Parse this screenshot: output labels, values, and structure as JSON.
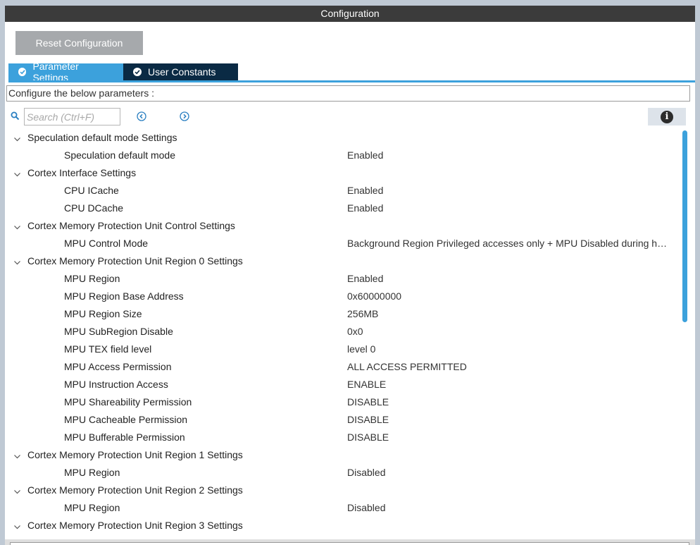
{
  "window": {
    "title": "Configuration"
  },
  "toolbar": {
    "reset_label": "Reset Configuration"
  },
  "tabs": [
    {
      "label": "Parameter Settings",
      "active": true
    },
    {
      "label": "User Constants",
      "active": false
    }
  ],
  "description": "Configure the below parameters :",
  "search": {
    "placeholder": "Search (Ctrl+F)"
  },
  "colors": {
    "accent": "#3ca1dc",
    "titlebar": "#3b3b3b",
    "tab_inactive": "#0a2a44",
    "button": "#a6a9ac"
  },
  "icons": {
    "search": "search-icon",
    "prev": "chevron-left-circle-icon",
    "next": "chevron-right-circle-icon",
    "info": "info-icon",
    "tab_check": "check-circle-icon",
    "expand": "chevron-down-icon"
  },
  "tree": {
    "groups": [
      {
        "label": "Speculation default mode Settings",
        "params": [
          {
            "name": "Speculation default mode",
            "value": "Enabled"
          }
        ]
      },
      {
        "label": "Cortex Interface Settings",
        "params": [
          {
            "name": "CPU ICache",
            "value": "Enabled"
          },
          {
            "name": "CPU DCache",
            "value": "Enabled"
          }
        ]
      },
      {
        "label": "Cortex Memory Protection Unit Control Settings",
        "params": [
          {
            "name": "MPU Control Mode",
            "value": "Background Region Privileged accesses only + MPU Disabled during hard fault"
          }
        ]
      },
      {
        "label": "Cortex Memory Protection Unit Region 0 Settings",
        "params": [
          {
            "name": "MPU Region",
            "value": "Enabled"
          },
          {
            "name": "MPU Region Base Address",
            "value": "0x60000000"
          },
          {
            "name": "MPU Region Size",
            "value": "256MB"
          },
          {
            "name": "MPU SubRegion Disable",
            "value": "0x0"
          },
          {
            "name": "MPU TEX field level",
            "value": "level 0"
          },
          {
            "name": "MPU Access Permission",
            "value": "ALL ACCESS PERMITTED"
          },
          {
            "name": "MPU Instruction Access",
            "value": "ENABLE"
          },
          {
            "name": "MPU Shareability Permission",
            "value": "DISABLE"
          },
          {
            "name": "MPU Cacheable Permission",
            "value": "DISABLE"
          },
          {
            "name": "MPU Bufferable  Permission",
            "value": "DISABLE"
          }
        ]
      },
      {
        "label": "Cortex Memory Protection Unit Region 1 Settings",
        "params": [
          {
            "name": "MPU Region",
            "value": "Disabled"
          }
        ]
      },
      {
        "label": "Cortex Memory Protection Unit Region 2 Settings",
        "params": [
          {
            "name": "MPU Region",
            "value": "Disabled"
          }
        ]
      },
      {
        "label": "Cortex Memory Protection Unit Region 3 Settings",
        "params": []
      }
    ]
  }
}
